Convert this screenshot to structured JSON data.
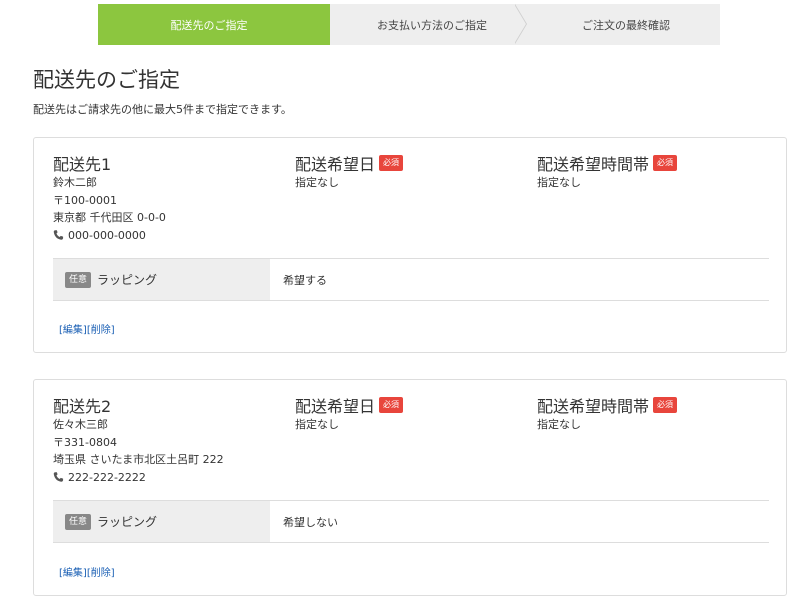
{
  "steps": [
    {
      "label": "配送先のご指定",
      "active": true
    },
    {
      "label": "お支払い方法のご指定",
      "active": false
    },
    {
      "label": "ご注文の最終確認",
      "active": false
    }
  ],
  "page": {
    "title": "配送先のご指定",
    "description": "配送先はご請求先の他に最大5件まで指定できます。"
  },
  "labels": {
    "required": "必須",
    "optional": "任意",
    "delivery_date": "配送希望日",
    "delivery_time": "配送希望時間帯",
    "wrapping": "ラッピング",
    "edit": "[編集]",
    "delete": "[削除]"
  },
  "colors": {
    "accent": "#8cc63f",
    "required_badge": "#e8453c",
    "optional_badge": "#888888",
    "link": "#1a5fb4"
  },
  "destinations": [
    {
      "heading": "配送先1",
      "name": "鈴木二郎",
      "postal": "〒100-0001",
      "address": "東京都 千代田区 0-0-0",
      "tel": "000-000-0000",
      "delivery_date": "指定なし",
      "delivery_time": "指定なし",
      "wrapping": "希望する"
    },
    {
      "heading": "配送先2",
      "name": "佐々木三郎",
      "postal": "〒331-0804",
      "address": "埼玉県 さいたま市北区土呂町 222",
      "tel": "222-222-2222",
      "delivery_date": "指定なし",
      "delivery_time": "指定なし",
      "wrapping": "希望しない"
    }
  ]
}
